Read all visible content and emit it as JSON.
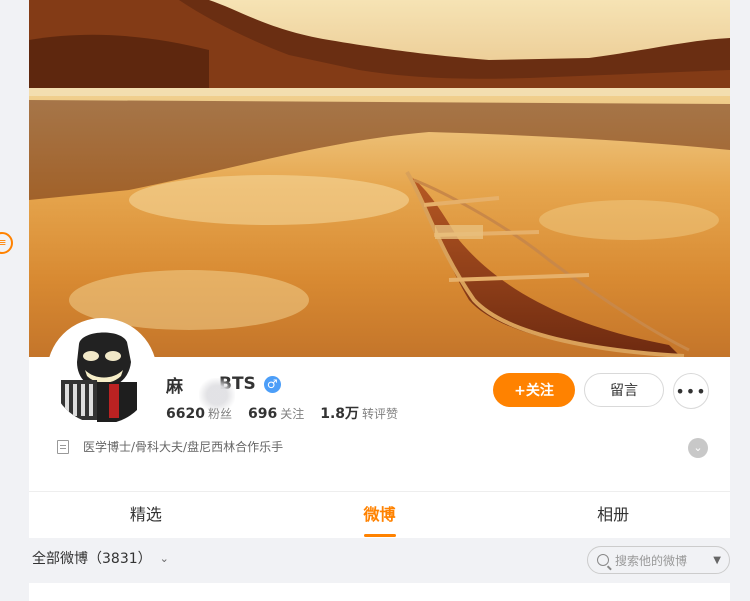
{
  "profile": {
    "name_prefix": "麻",
    "name_suffix": "BTS",
    "gender_symbol": "♂",
    "followers_count": "6620",
    "followers_label": "粉丝",
    "following_count": "696",
    "following_label": "关注",
    "interactions_count": "1.8万",
    "interactions_label": "转评赞",
    "bio": "医学博士/骨科大夫/盘尼西林合作乐手"
  },
  "actions": {
    "follow_label": "+关注",
    "message_label": "留言",
    "more_label": "•••"
  },
  "tabs": [
    {
      "label": "精选",
      "active": false
    },
    {
      "label": "微博",
      "active": true
    },
    {
      "label": "相册",
      "active": false
    }
  ],
  "feed": {
    "filter_label": "全部微博（3831）",
    "search_placeholder": "搜索他的微博"
  },
  "colors": {
    "accent": "#ff8200",
    "verified_blue": "#4c9ef8",
    "page_background": "#f1f2f5"
  },
  "icons": {
    "bio": "doc-icon",
    "expand": "chevron-down-icon",
    "search": "search-icon",
    "gender": "male-icon"
  }
}
